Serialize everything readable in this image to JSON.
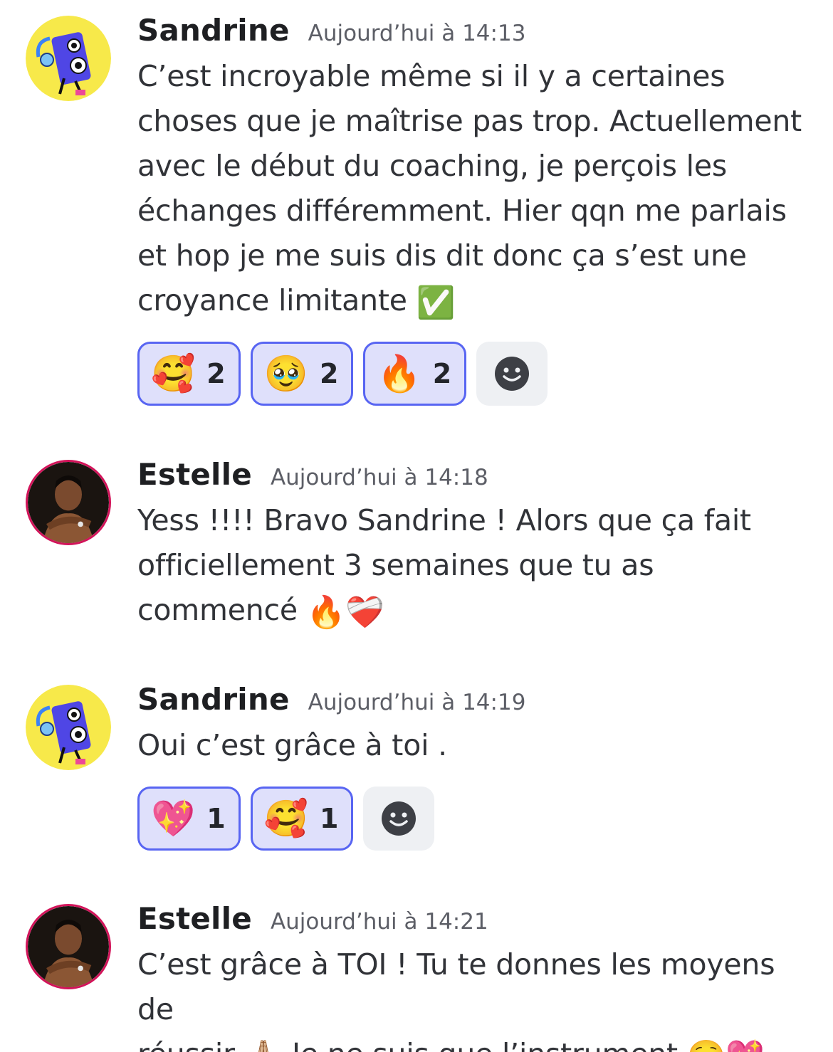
{
  "messages": [
    {
      "author": "Sandrine",
      "timestamp": "Aujourd’hui à 14:13",
      "avatar": "speaker-mascot-avatar",
      "text": "C’est incroyable même si il y a certaines\nchoses que je maîtrise pas trop. Actuellement\navec le début du coaching, je perçois les\néchanges différemment. Hier qqn me parlais\net hop je me suis dis dit donc ça s’est une\ncroyance limitante ",
      "text_emoji": "✅",
      "reactions": [
        {
          "emoji": "🥰",
          "count": "2"
        },
        {
          "emoji": "🥹",
          "count": "2"
        },
        {
          "emoji": "🔥",
          "count": "2"
        }
      ]
    },
    {
      "author": "Estelle",
      "timestamp": "Aujourd’hui à 14:18",
      "avatar": "woman-photo-avatar",
      "text": "Yess !!!! Bravo Sandrine ! Alors que ça fait\nofficiellement 3 semaines que tu as\ncommencé ",
      "text_emoji": "🔥❤️‍🩹"
    },
    {
      "author": "Sandrine",
      "timestamp": "Aujourd’hui à 14:19",
      "avatar": "speaker-mascot-avatar",
      "text": "Oui c’est grâce à toi .",
      "reactions": [
        {
          "emoji": "💖",
          "count": "1"
        },
        {
          "emoji": "🥰",
          "count": "1"
        }
      ]
    },
    {
      "author": "Estelle",
      "timestamp": "Aujourd’hui à 14:21",
      "avatar": "woman-photo-avatar",
      "text": "C’est grâce à TOI ! Tu te donnes les moyens de\nréussir ",
      "text_emoji": "🙏🏼",
      "text_tail": " Je ne suis que l’instrument ",
      "text_tail_emoji": "☺️💖"
    }
  ],
  "add_reaction_icon": "smiley-add-reaction-icon",
  "colors": {
    "reaction_border": "#5865f2",
    "reaction_bg": "#dfe0fb",
    "add_reaction_bg": "#eef0f3",
    "mascot_bg": "#f7e94a",
    "estelle_ring": "#d2145a"
  }
}
